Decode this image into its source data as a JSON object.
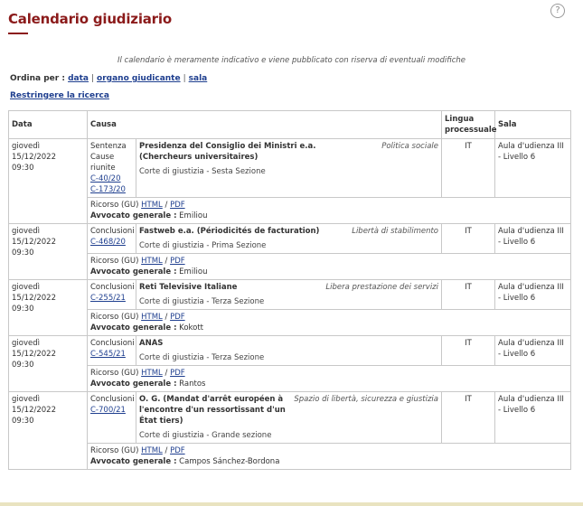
{
  "header": {
    "title": "Calendario giudiziario",
    "help_icon": "?"
  },
  "disclaimer": "Il calendario è meramente indicativo e viene pubblicato con riserva di eventuali modifiche",
  "sort": {
    "label": "Ordina per :",
    "options": [
      "data",
      "organo giudicante",
      "sala"
    ],
    "sep": "|"
  },
  "restrict_link": "Restringere la ricerca",
  "table": {
    "headers": {
      "date": "Data",
      "cause": "Causa",
      "language": "Lingua processuale",
      "room": "Sala"
    },
    "rows": [
      {
        "date": "giovedì 15/12/2022",
        "time": "09:30",
        "procedure": "Sentenza Cause riunite",
        "case_numbers": [
          "C-40/20",
          "C-173/20"
        ],
        "parties": "Presidenza del Consiglio dei Ministri e.a. (Chercheurs universitaires)",
        "matter": "Politica sociale",
        "court": "Corte di giustizia - Sesta Sezione",
        "language": "IT",
        "room": "Aula d'udienza III - Livello 6",
        "ricorso": "Ricorso (GU)",
        "html": "HTML",
        "slash": "/",
        "pdf": "PDF",
        "ag_label": "Avvocato generale :",
        "ag_name": "Emiliou"
      },
      {
        "date": "giovedì 15/12/2022",
        "time": "09:30",
        "procedure": "Conclusioni",
        "case_numbers": [
          "C-468/20"
        ],
        "parties": "Fastweb e.a. (Périodicités de facturation)",
        "matter": "Libertà di stabilimento",
        "court": "Corte di giustizia - Prima Sezione",
        "language": "IT",
        "room": "Aula d'udienza III - Livello 6",
        "ricorso": "Ricorso (GU)",
        "html": "HTML",
        "slash": "/",
        "pdf": "PDF",
        "ag_label": "Avvocato generale :",
        "ag_name": "Emiliou"
      },
      {
        "date": "giovedì 15/12/2022",
        "time": "09:30",
        "procedure": "Conclusioni",
        "case_numbers": [
          "C-255/21"
        ],
        "parties": "Reti Televisive Italiane",
        "matter": "Libera prestazione dei servizi",
        "court": "Corte di giustizia - Terza Sezione",
        "language": "IT",
        "room": "Aula d'udienza III - Livello 6",
        "ricorso": "Ricorso (GU)",
        "html": "HTML",
        "slash": "/",
        "pdf": "PDF",
        "ag_label": "Avvocato generale :",
        "ag_name": "Kokott"
      },
      {
        "date": "giovedì 15/12/2022",
        "time": "09:30",
        "procedure": "Conclusioni",
        "case_numbers": [
          "C-545/21"
        ],
        "parties": "ANAS",
        "matter": "",
        "court": "Corte di giustizia - Terza Sezione",
        "language": "IT",
        "room": "Aula d'udienza III - Livello 6",
        "ricorso": "Ricorso (GU)",
        "html": "HTML",
        "slash": "/",
        "pdf": "PDF",
        "ag_label": "Avvocato generale :",
        "ag_name": "Rantos"
      },
      {
        "date": "giovedì 15/12/2022",
        "time": "09:30",
        "procedure": "Conclusioni",
        "case_numbers": [
          "C-700/21"
        ],
        "parties": "O. G. (Mandat d'arrêt européen à l'encontre d'un ressortissant d'un État tiers)",
        "matter": "Spazio di libertà, sicurezza e giustizia",
        "court": "Corte di giustizia - Grande sezione",
        "language": "IT",
        "room": "Aula d'udienza III - Livello 6",
        "ricorso": "Ricorso (GU)",
        "html": "HTML",
        "slash": "/",
        "pdf": "PDF",
        "ag_label": "Avvocato generale :",
        "ag_name": "Campos Sánchez-Bordona"
      }
    ]
  }
}
